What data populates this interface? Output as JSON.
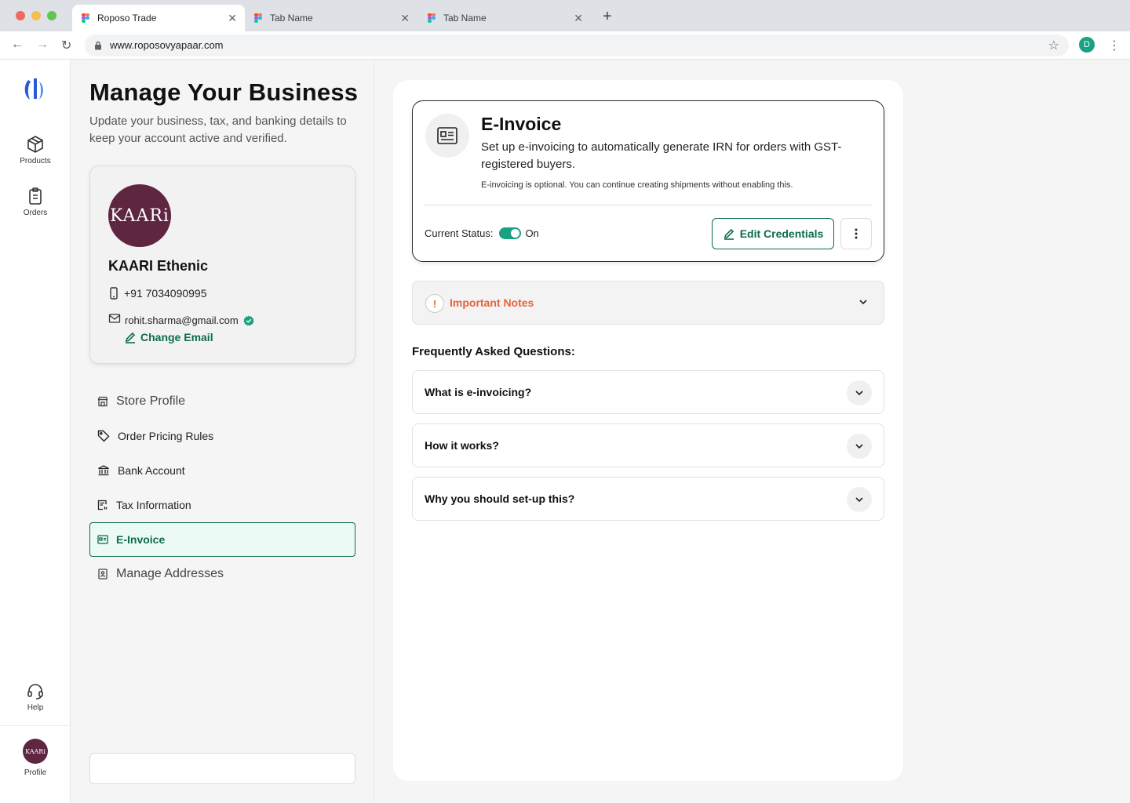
{
  "browser": {
    "tabs": [
      {
        "label": "Roposo Trade",
        "active": true
      },
      {
        "label": "Tab Name",
        "active": false
      },
      {
        "label": "Tab Name",
        "active": false
      }
    ],
    "url": "www.roposovyapaar.com",
    "profile_initial": "D"
  },
  "rail": {
    "items": [
      {
        "label": "Products",
        "icon": "box-icon"
      },
      {
        "label": "Orders",
        "icon": "clipboard-icon"
      }
    ],
    "help_label": "Help",
    "profile_label": "Profile",
    "avatar_text": "KAARi"
  },
  "left": {
    "title": "Manage Your Business",
    "subtitle": "Update your business, tax, and banking details to keep your account active and verified.",
    "business": {
      "logo_text": "KAARi",
      "name": "KAARI Ethenic",
      "phone": "+91 7034090995",
      "email": "rohit.sharma@gmail.com",
      "change_email_label": "Change Email"
    },
    "menu": [
      {
        "label": "Store Profile",
        "icon": "store-icon"
      },
      {
        "label": "Order Pricing Rules",
        "icon": "tag-icon"
      },
      {
        "label": "Bank Account",
        "icon": "bank-icon"
      },
      {
        "label": "Tax Information",
        "icon": "tax-icon"
      },
      {
        "label": "E-Invoice",
        "icon": "invoice-icon",
        "active": true
      },
      {
        "label": "Manage Addresses",
        "icon": "address-book-icon"
      }
    ]
  },
  "einvoice": {
    "title": "E-Invoice",
    "description": "Set up e-invoicing to automatically generate IRN for orders with GST-registered buyers.",
    "note": "E-invoicing is optional. You can continue creating shipments without enabling this.",
    "status_label": "Current Status:",
    "status_value": "On",
    "edit_label": "Edit Credentials"
  },
  "notes": {
    "label": "Important Notes"
  },
  "faq": {
    "heading": "Frequently Asked Questions:",
    "items": [
      {
        "question": "What is e-invoicing?"
      },
      {
        "question": "How it works?"
      },
      {
        "question": "Why you should set-up this?"
      }
    ]
  },
  "colors": {
    "accent": "#0d6b4f",
    "toggle": "#1aa181",
    "warning": "#e8633c",
    "brand_avatar": "#5e2640"
  }
}
